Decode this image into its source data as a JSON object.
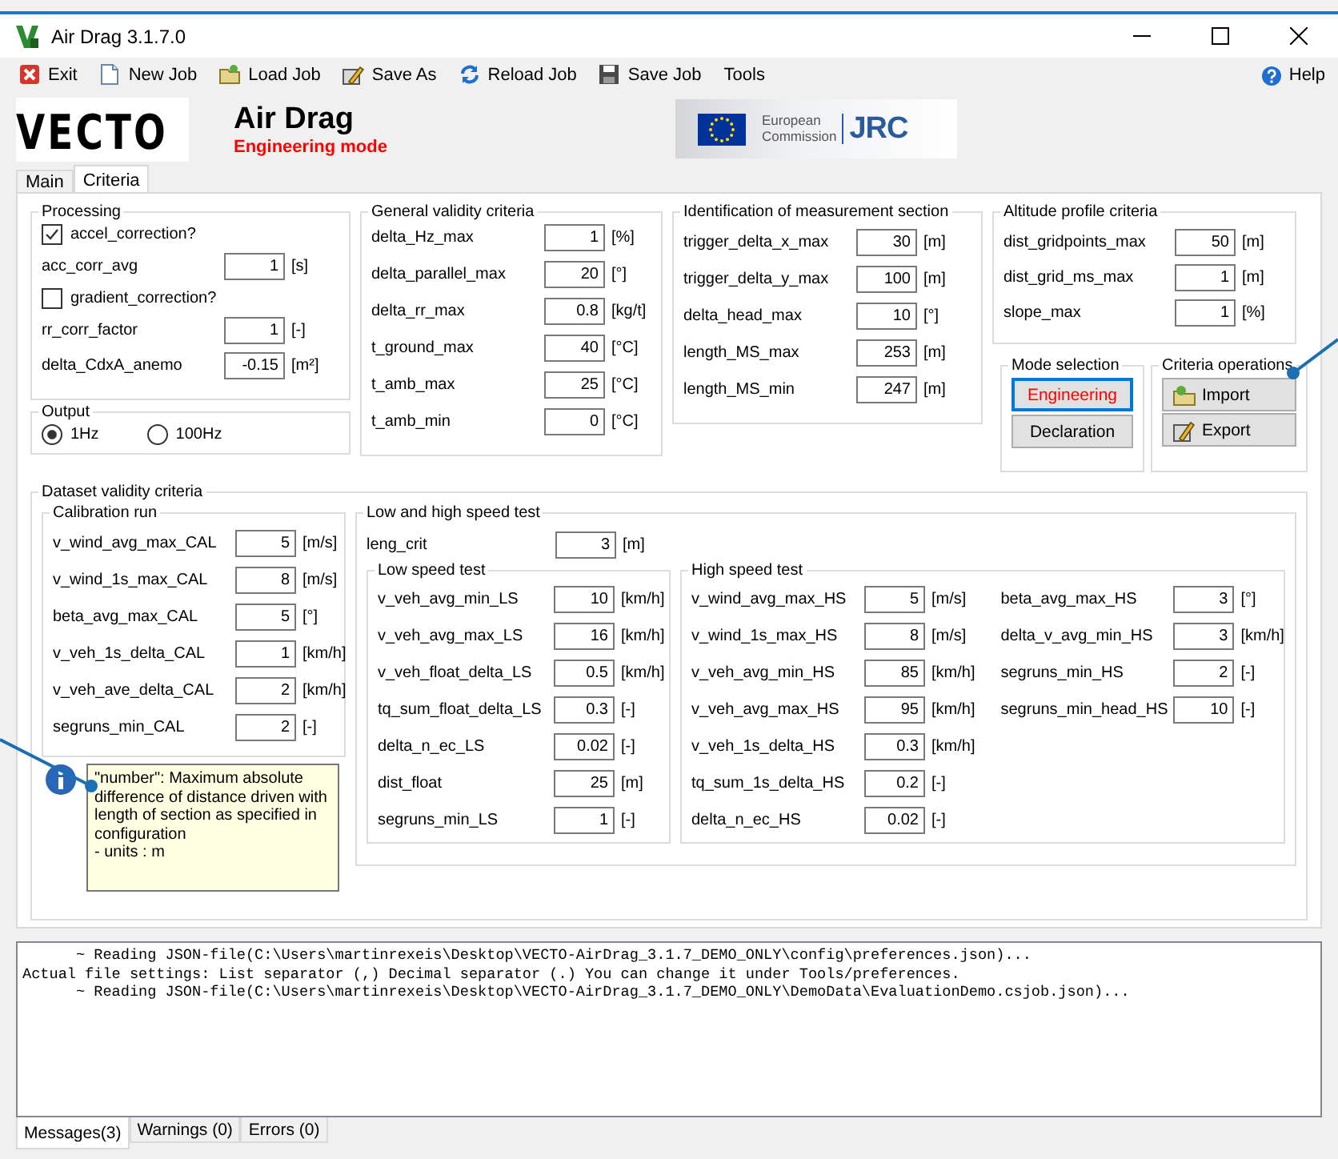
{
  "window": {
    "title": "Air Drag 3.1.7.0"
  },
  "menu": [
    {
      "label": "Exit",
      "kind": "exit"
    },
    {
      "label": "New Job",
      "kind": "new"
    },
    {
      "label": "Load Job",
      "kind": "load"
    },
    {
      "label": "Save As",
      "kind": "saveas"
    },
    {
      "label": "Reload Job",
      "kind": "reload"
    },
    {
      "label": "Save Job",
      "kind": "save"
    },
    {
      "label": "Tools",
      "kind": "plain"
    }
  ],
  "help_menu": {
    "label": "Help"
  },
  "header": {
    "logo": "VECTO",
    "title": "Air Drag",
    "mode": "Engineering mode",
    "eu_name": "European",
    "eu_name_2": "Commission",
    "jrc": "JRC"
  },
  "tabs": [
    {
      "label": "Main",
      "selected": false
    },
    {
      "label": "Criteria",
      "selected": true
    }
  ],
  "processing": {
    "title": "Processing",
    "rows": [
      {
        "kind": "checkbox",
        "label": "accel_correction?",
        "checked": true
      },
      {
        "kind": "field",
        "label": "acc_corr_avg",
        "value": "1",
        "unit": "[s]"
      },
      {
        "kind": "checkbox",
        "label": "gradient_correction?",
        "checked": false
      },
      {
        "kind": "field",
        "label": "rr_corr_factor",
        "value": "1",
        "unit": "[-]"
      },
      {
        "kind": "field",
        "label": "delta_CdxA_anemo",
        "value": "-0.15",
        "unit": "[m²]"
      }
    ]
  },
  "output": {
    "title": "Output",
    "options": [
      {
        "label": "1Hz",
        "selected": true
      },
      {
        "label": "100Hz",
        "selected": false
      }
    ]
  },
  "general": {
    "title": "General validity criteria",
    "rows": [
      {
        "label": "delta_Hz_max",
        "value": "1",
        "unit": "[%]"
      },
      {
        "label": "delta_parallel_max",
        "value": "20",
        "unit": "[°]"
      },
      {
        "label": "delta_rr_max",
        "value": "0.8",
        "unit": "[kg/t]"
      },
      {
        "label": "t_ground_max",
        "value": "40",
        "unit": "[°C]"
      },
      {
        "label": "t_amb_max",
        "value": "25",
        "unit": "[°C]"
      },
      {
        "label": "t_amb_min",
        "value": "0",
        "unit": "[°C]"
      }
    ]
  },
  "identification": {
    "title": "Identification of measurement section",
    "rows": [
      {
        "label": "trigger_delta_x_max",
        "value": "30",
        "unit": "[m]"
      },
      {
        "label": "trigger_delta_y_max",
        "value": "100",
        "unit": "[m]"
      },
      {
        "label": "delta_head_max",
        "value": "10",
        "unit": "[°]"
      },
      {
        "label": "length_MS_max",
        "value": "253",
        "unit": "[m]"
      },
      {
        "label": "length_MS_min",
        "value": "247",
        "unit": "[m]"
      }
    ]
  },
  "altitude": {
    "title": "Altitude profile criteria",
    "rows": [
      {
        "label": "dist_gridpoints_max",
        "value": "50",
        "unit": "[m]"
      },
      {
        "label": "dist_grid_ms_max",
        "value": "1",
        "unit": "[m]"
      },
      {
        "label": "slope_max",
        "value": "1",
        "unit": "[%]"
      }
    ]
  },
  "mode_selection": {
    "title": "Mode selection",
    "buttons": [
      {
        "label": "Engineering",
        "selected": true
      },
      {
        "label": "Declaration",
        "selected": false
      }
    ]
  },
  "criteria_operations": {
    "title": "Criteria operations",
    "buttons": [
      {
        "label": "Import",
        "kind": "import"
      },
      {
        "label": "Export",
        "kind": "export"
      }
    ]
  },
  "dataset": {
    "title": "Dataset validity criteria",
    "calibration": {
      "title": "Calibration run",
      "rows": [
        {
          "label": "v_wind_avg_max_CAL",
          "value": "5",
          "unit": "[m/s]"
        },
        {
          "label": "v_wind_1s_max_CAL",
          "value": "8",
          "unit": "[m/s]"
        },
        {
          "label": "beta_avg_max_CAL",
          "value": "5",
          "unit": "[°]"
        },
        {
          "label": "v_veh_1s_delta_CAL",
          "value": "1",
          "unit": "[km/h]"
        },
        {
          "label": "v_veh_ave_delta_CAL",
          "value": "2",
          "unit": "[km/h]"
        },
        {
          "label": "segruns_min_CAL",
          "value": "2",
          "unit": "[-]"
        }
      ]
    },
    "tooltip": {
      "lines": [
        "\"number\": Maximum absolute difference of distance driven with length of section as specified in configuration",
        "- units : m"
      ]
    },
    "speed": {
      "title": "Low and high speed test",
      "leng_crit": {
        "label": "leng_crit",
        "value": "3",
        "unit": "[m]"
      },
      "low": {
        "title": "Low speed test",
        "rows": [
          {
            "label": "v_veh_avg_min_LS",
            "value": "10",
            "unit": "[km/h]"
          },
          {
            "label": "v_veh_avg_max_LS",
            "value": "16",
            "unit": "[km/h]"
          },
          {
            "label": "v_veh_float_delta_LS",
            "value": "0.5",
            "unit": "[km/h]"
          },
          {
            "label": "tq_sum_float_delta_LS",
            "value": "0.3",
            "unit": "[-]"
          },
          {
            "label": "delta_n_ec_LS",
            "value": "0.02",
            "unit": "[-]"
          },
          {
            "label": "dist_float",
            "value": "25",
            "unit": "[m]"
          },
          {
            "label": "segruns_min_LS",
            "value": "1",
            "unit": "[-]"
          }
        ]
      },
      "high": {
        "title": "High speed test",
        "columns": [
          [
            {
              "label": "v_wind_avg_max_HS",
              "value": "5",
              "unit": "[m/s]"
            },
            {
              "label": "v_wind_1s_max_HS",
              "value": "8",
              "unit": "[m/s]"
            },
            {
              "label": "v_veh_avg_min_HS",
              "value": "85",
              "unit": "[km/h]"
            },
            {
              "label": "v_veh_avg_max_HS",
              "value": "95",
              "unit": "[km/h]"
            },
            {
              "label": "v_veh_1s_delta_HS",
              "value": "0.3",
              "unit": "[km/h]"
            },
            {
              "label": "tq_sum_1s_delta_HS",
              "value": "0.2",
              "unit": "[-]"
            },
            {
              "label": "delta_n_ec_HS",
              "value": "0.02",
              "unit": "[-]"
            }
          ],
          [
            {
              "label": "beta_avg_max_HS",
              "value": "3",
              "unit": "[°]"
            },
            {
              "label": "delta_v_avg_min_HS",
              "value": "3",
              "unit": "[km/h]"
            },
            {
              "label": "segruns_min_HS",
              "value": "2",
              "unit": "[-]"
            },
            {
              "label": "segruns_min_head_HS",
              "value": "10",
              "unit": "[-]"
            }
          ]
        ]
      }
    }
  },
  "log": {
    "lines": [
      "      ~ Reading JSON-file(C:\\Users\\martinrexeis\\Desktop\\VECTO-AirDrag_3.1.7_DEMO_ONLY\\config\\preferences.json)...",
      "Actual file settings: List separator (,) Decimal separator (.) You can change it under Tools/preferences.",
      "      ~ Reading JSON-file(C:\\Users\\martinrexeis\\Desktop\\VECTO-AirDrag_3.1.7_DEMO_ONLY\\DemoData\\EvaluationDemo.csjob.json)..."
    ]
  },
  "log_tabs": [
    {
      "label": "Messages(3)",
      "selected": true
    },
    {
      "label": "Warnings (0)",
      "selected": false
    },
    {
      "label": "Errors (0)",
      "selected": false
    }
  ]
}
